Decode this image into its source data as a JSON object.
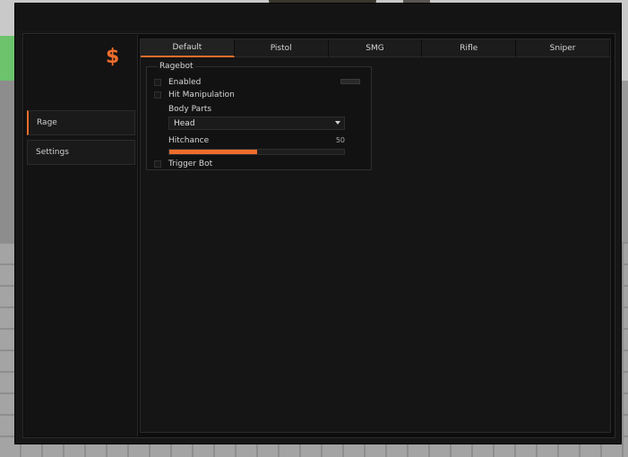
{
  "app": {
    "logo": "$",
    "accent": "#ee6d2c"
  },
  "sidebar": {
    "items": [
      {
        "label": "Rage",
        "active": true
      },
      {
        "label": "Settings",
        "active": false
      }
    ]
  },
  "tabs": [
    {
      "label": "Default",
      "active": true
    },
    {
      "label": "Pistol",
      "active": false
    },
    {
      "label": "SMG",
      "active": false
    },
    {
      "label": "Rifle",
      "active": false
    },
    {
      "label": "Sniper",
      "active": false
    }
  ],
  "ragebot": {
    "title": "Ragebot",
    "enabled": {
      "label": "Enabled",
      "checked": false
    },
    "hit_manipulation": {
      "label": "Hit Manipulation",
      "checked": false
    },
    "body_parts": {
      "label": "Body Parts",
      "value": "Head"
    },
    "hitchance": {
      "label": "Hitchance",
      "value": "50",
      "max": 100
    },
    "trigger_bot": {
      "label": "Trigger Bot",
      "checked": false
    }
  }
}
